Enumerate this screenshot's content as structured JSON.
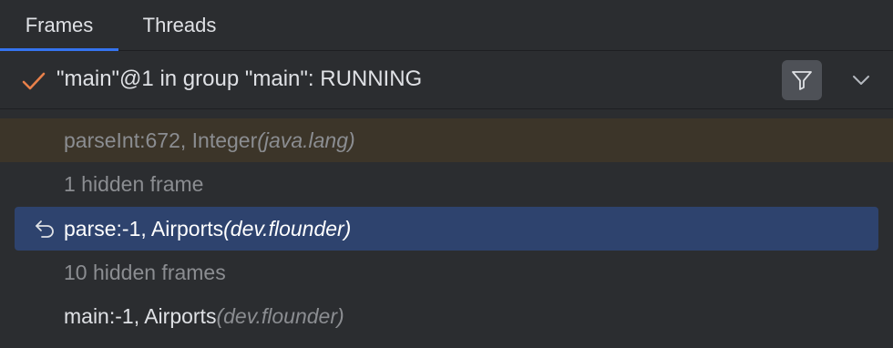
{
  "tabs": [
    {
      "label": "Frames",
      "selected": true
    },
    {
      "label": "Threads",
      "selected": false
    }
  ],
  "thread": {
    "label": "\"main\"@1 in group \"main\": RUNNING",
    "status_icon": "check-icon",
    "filter_icon": "filter-icon",
    "dropdown_icon": "chevron-down-icon"
  },
  "frames": [
    {
      "method": "parseInt:672, Integer ",
      "package": "(java.lang)",
      "state": "library"
    },
    {
      "method": "1 hidden frame",
      "package": "",
      "state": "hidden"
    },
    {
      "method": "parse:-1, Airports ",
      "package": "(dev.flounder)",
      "state": "selected",
      "icon": "return-arrow-icon"
    },
    {
      "method": "10 hidden frames",
      "package": "",
      "state": "hidden"
    },
    {
      "method": "main:-1, Airports ",
      "package": "(dev.flounder)",
      "state": "normal"
    }
  ],
  "colors": {
    "background": "#2b2d30",
    "accent": "#3574f0",
    "selection": "#2e436e",
    "library_row": "#3c3529",
    "check": "#e8804a",
    "muted_text": "#8b8d91"
  }
}
